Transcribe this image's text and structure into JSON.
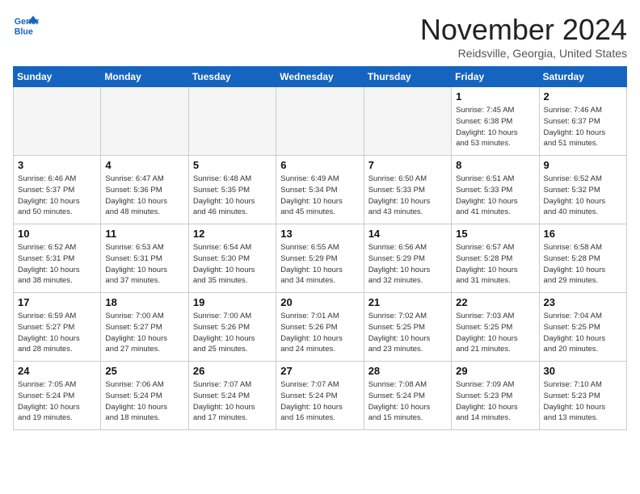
{
  "logo": {
    "line1": "General",
    "line2": "Blue"
  },
  "title": "November 2024",
  "location": "Reidsville, Georgia, United States",
  "weekdays": [
    "Sunday",
    "Monday",
    "Tuesday",
    "Wednesday",
    "Thursday",
    "Friday",
    "Saturday"
  ],
  "weeks": [
    [
      {
        "day": "",
        "info": ""
      },
      {
        "day": "",
        "info": ""
      },
      {
        "day": "",
        "info": ""
      },
      {
        "day": "",
        "info": ""
      },
      {
        "day": "",
        "info": ""
      },
      {
        "day": "1",
        "info": "Sunrise: 7:45 AM\nSunset: 6:38 PM\nDaylight: 10 hours\nand 53 minutes."
      },
      {
        "day": "2",
        "info": "Sunrise: 7:46 AM\nSunset: 6:37 PM\nDaylight: 10 hours\nand 51 minutes."
      }
    ],
    [
      {
        "day": "3",
        "info": "Sunrise: 6:46 AM\nSunset: 5:37 PM\nDaylight: 10 hours\nand 50 minutes."
      },
      {
        "day": "4",
        "info": "Sunrise: 6:47 AM\nSunset: 5:36 PM\nDaylight: 10 hours\nand 48 minutes."
      },
      {
        "day": "5",
        "info": "Sunrise: 6:48 AM\nSunset: 5:35 PM\nDaylight: 10 hours\nand 46 minutes."
      },
      {
        "day": "6",
        "info": "Sunrise: 6:49 AM\nSunset: 5:34 PM\nDaylight: 10 hours\nand 45 minutes."
      },
      {
        "day": "7",
        "info": "Sunrise: 6:50 AM\nSunset: 5:33 PM\nDaylight: 10 hours\nand 43 minutes."
      },
      {
        "day": "8",
        "info": "Sunrise: 6:51 AM\nSunset: 5:33 PM\nDaylight: 10 hours\nand 41 minutes."
      },
      {
        "day": "9",
        "info": "Sunrise: 6:52 AM\nSunset: 5:32 PM\nDaylight: 10 hours\nand 40 minutes."
      }
    ],
    [
      {
        "day": "10",
        "info": "Sunrise: 6:52 AM\nSunset: 5:31 PM\nDaylight: 10 hours\nand 38 minutes."
      },
      {
        "day": "11",
        "info": "Sunrise: 6:53 AM\nSunset: 5:31 PM\nDaylight: 10 hours\nand 37 minutes."
      },
      {
        "day": "12",
        "info": "Sunrise: 6:54 AM\nSunset: 5:30 PM\nDaylight: 10 hours\nand 35 minutes."
      },
      {
        "day": "13",
        "info": "Sunrise: 6:55 AM\nSunset: 5:29 PM\nDaylight: 10 hours\nand 34 minutes."
      },
      {
        "day": "14",
        "info": "Sunrise: 6:56 AM\nSunset: 5:29 PM\nDaylight: 10 hours\nand 32 minutes."
      },
      {
        "day": "15",
        "info": "Sunrise: 6:57 AM\nSunset: 5:28 PM\nDaylight: 10 hours\nand 31 minutes."
      },
      {
        "day": "16",
        "info": "Sunrise: 6:58 AM\nSunset: 5:28 PM\nDaylight: 10 hours\nand 29 minutes."
      }
    ],
    [
      {
        "day": "17",
        "info": "Sunrise: 6:59 AM\nSunset: 5:27 PM\nDaylight: 10 hours\nand 28 minutes."
      },
      {
        "day": "18",
        "info": "Sunrise: 7:00 AM\nSunset: 5:27 PM\nDaylight: 10 hours\nand 27 minutes."
      },
      {
        "day": "19",
        "info": "Sunrise: 7:00 AM\nSunset: 5:26 PM\nDaylight: 10 hours\nand 25 minutes."
      },
      {
        "day": "20",
        "info": "Sunrise: 7:01 AM\nSunset: 5:26 PM\nDaylight: 10 hours\nand 24 minutes."
      },
      {
        "day": "21",
        "info": "Sunrise: 7:02 AM\nSunset: 5:25 PM\nDaylight: 10 hours\nand 23 minutes."
      },
      {
        "day": "22",
        "info": "Sunrise: 7:03 AM\nSunset: 5:25 PM\nDaylight: 10 hours\nand 21 minutes."
      },
      {
        "day": "23",
        "info": "Sunrise: 7:04 AM\nSunset: 5:25 PM\nDaylight: 10 hours\nand 20 minutes."
      }
    ],
    [
      {
        "day": "24",
        "info": "Sunrise: 7:05 AM\nSunset: 5:24 PM\nDaylight: 10 hours\nand 19 minutes."
      },
      {
        "day": "25",
        "info": "Sunrise: 7:06 AM\nSunset: 5:24 PM\nDaylight: 10 hours\nand 18 minutes."
      },
      {
        "day": "26",
        "info": "Sunrise: 7:07 AM\nSunset: 5:24 PM\nDaylight: 10 hours\nand 17 minutes."
      },
      {
        "day": "27",
        "info": "Sunrise: 7:07 AM\nSunset: 5:24 PM\nDaylight: 10 hours\nand 16 minutes."
      },
      {
        "day": "28",
        "info": "Sunrise: 7:08 AM\nSunset: 5:24 PM\nDaylight: 10 hours\nand 15 minutes."
      },
      {
        "day": "29",
        "info": "Sunrise: 7:09 AM\nSunset: 5:23 PM\nDaylight: 10 hours\nand 14 minutes."
      },
      {
        "day": "30",
        "info": "Sunrise: 7:10 AM\nSunset: 5:23 PM\nDaylight: 10 hours\nand 13 minutes."
      }
    ]
  ]
}
